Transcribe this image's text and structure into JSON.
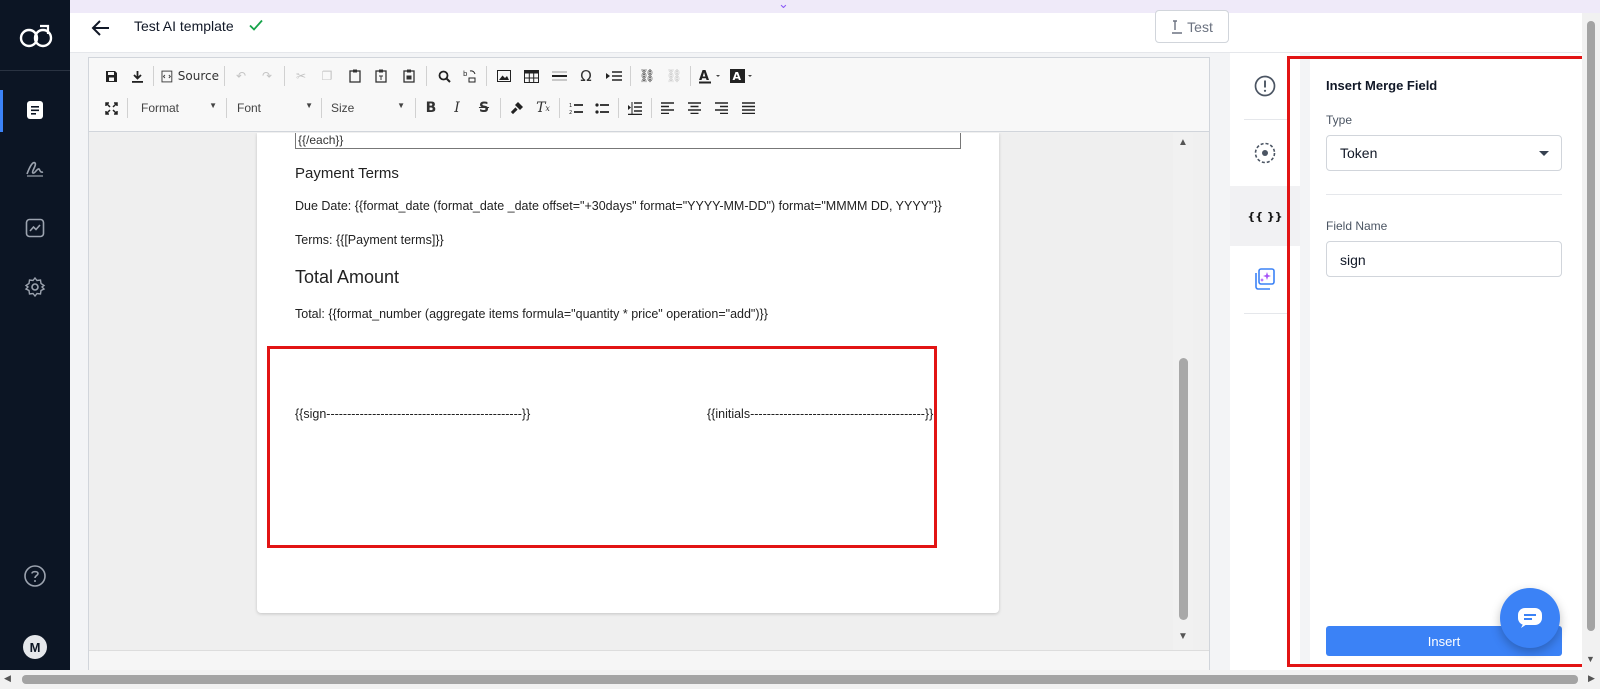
{
  "header": {
    "title": "Test AI template",
    "test_label": "Test"
  },
  "nav": {
    "avatar_initial": "M"
  },
  "toolbar": {
    "source_label": "Source",
    "format_label": "Format",
    "font_label": "Font",
    "size_label": "Size"
  },
  "document": {
    "each_close": "{{/each}}",
    "payment_heading": "Payment Terms",
    "due_date": "Due Date: {{format_date (format_date _date offset=\"+30days\" format=\"YYYY-MM-DD\") format=\"MMMM DD, YYYY\"}}",
    "terms": "Terms: {{[Payment terms]}}",
    "total_heading": "Total Amount",
    "total": "Total: {{format_number (aggregate items formula=\"quantity * price\" operation=\"add\")}}",
    "sign_token": "{{sign-----------------------------------------------}}",
    "initials_token": "{{initials------------------------------------------}}"
  },
  "sidetabs": {
    "merge_tab_label": "{{ }}"
  },
  "panel": {
    "title": "Insert Merge Field",
    "type_label": "Type",
    "type_value": "Token",
    "field_name_label": "Field Name",
    "field_name_value": "sign",
    "insert_label": "Insert"
  },
  "colors": {
    "accent": "#3b82f6",
    "highlight": "#e21414",
    "nav_bg": "#0c1524",
    "check": "#16a34a"
  },
  "icons": [
    "logo-icon",
    "document-icon",
    "signature-icon",
    "analytics-icon",
    "settings-icon",
    "help-icon",
    "back-arrow-icon",
    "check-icon",
    "info-icon",
    "target-icon",
    "merge-field-icon",
    "ai-sparkle-icon",
    "chat-icon"
  ]
}
